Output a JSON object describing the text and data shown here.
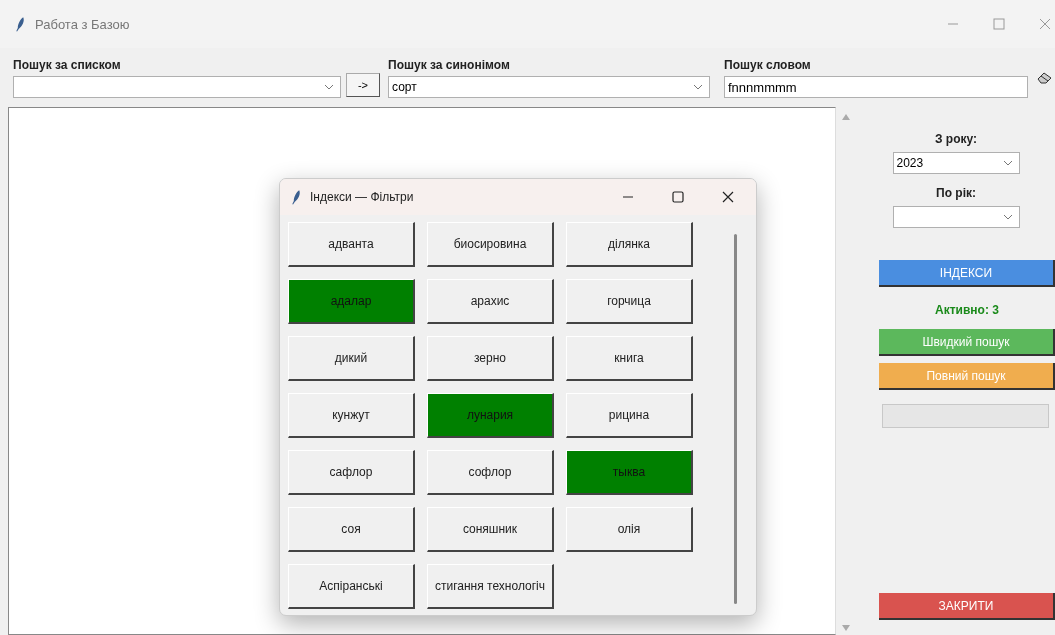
{
  "window": {
    "title": "Работа з Базою"
  },
  "search": [
    {
      "kind": "combo",
      "label": "Пошук за списком"
    },
    {
      "kind": "button",
      "label": "->"
    },
    {
      "kind": "combo",
      "label": "Пошук за синонімом",
      "value": "сорт"
    },
    {
      "kind": "entry",
      "label": "Пошук словом",
      "value": "fnnnmmmm"
    }
  ],
  "panel": [
    {
      "kind": "label",
      "text": "З року:"
    },
    {
      "kind": "combo",
      "value": "2023"
    },
    {
      "kind": "label",
      "text": "По рік:"
    },
    {
      "kind": "combo"
    },
    {
      "kind": "button",
      "text": "ІНДЕКСИ",
      "color": "#4a8ee0"
    },
    {
      "kind": "status",
      "text": "Активно: 3"
    },
    {
      "kind": "button",
      "text": "Швидкий пошук",
      "color": "#5cb85c"
    },
    {
      "kind": "button",
      "text": "Повний пошук",
      "color": "#f0ad4e"
    },
    {
      "kind": "field"
    },
    {
      "kind": "close",
      "text": "ЗАКРИТИ",
      "color": "#d9534f"
    }
  ],
  "dialog": {
    "title": "Індекси — Фільтри",
    "tags": [
      {
        "label": "адванта",
        "selected": false
      },
      {
        "label": "биосировина",
        "selected": false
      },
      {
        "label": "ділянка",
        "selected": false
      },
      {
        "label": "адалар",
        "selected": true
      },
      {
        "label": "арахис",
        "selected": false
      },
      {
        "label": "горчица",
        "selected": false
      },
      {
        "label": "дикий",
        "selected": false
      },
      {
        "label": "зерно",
        "selected": false
      },
      {
        "label": "книга",
        "selected": false
      },
      {
        "label": "кунжут",
        "selected": false
      },
      {
        "label": "лунария",
        "selected": true
      },
      {
        "label": "рицина",
        "selected": false
      },
      {
        "label": "сафлор",
        "selected": false
      },
      {
        "label": "софлор",
        "selected": false
      },
      {
        "label": "тыква",
        "selected": true
      },
      {
        "label": "соя",
        "selected": false
      },
      {
        "label": "соняшник",
        "selected": false
      },
      {
        "label": "олія",
        "selected": false
      },
      {
        "label": "Аспіранські",
        "selected": false
      },
      {
        "label": "стигання технологіч",
        "selected": false
      }
    ]
  }
}
